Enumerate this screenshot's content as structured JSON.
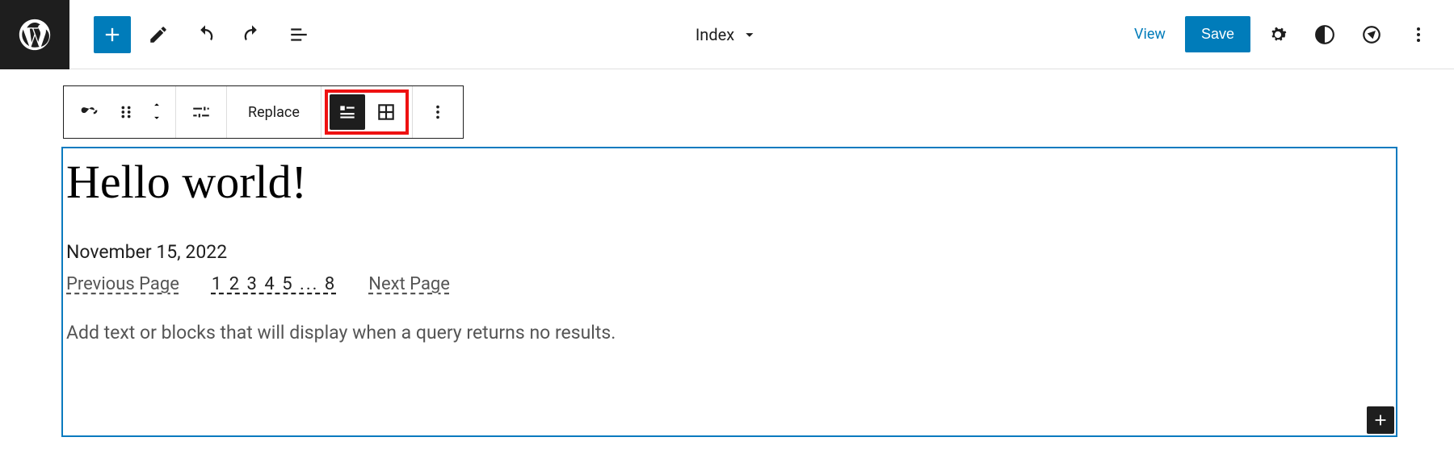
{
  "header": {
    "template_name": "Index",
    "view_label": "View",
    "save_label": "Save"
  },
  "block_toolbar": {
    "replace_label": "Replace"
  },
  "canvas": {
    "post_title": "Hello world!",
    "post_date": "November 15, 2022",
    "pagination": {
      "prev": "Previous Page",
      "numbers": "1 2 3 4 5 ... 8",
      "next": "Next Page"
    },
    "no_results_placeholder": "Add text or blocks that will display when a query returns no results."
  }
}
